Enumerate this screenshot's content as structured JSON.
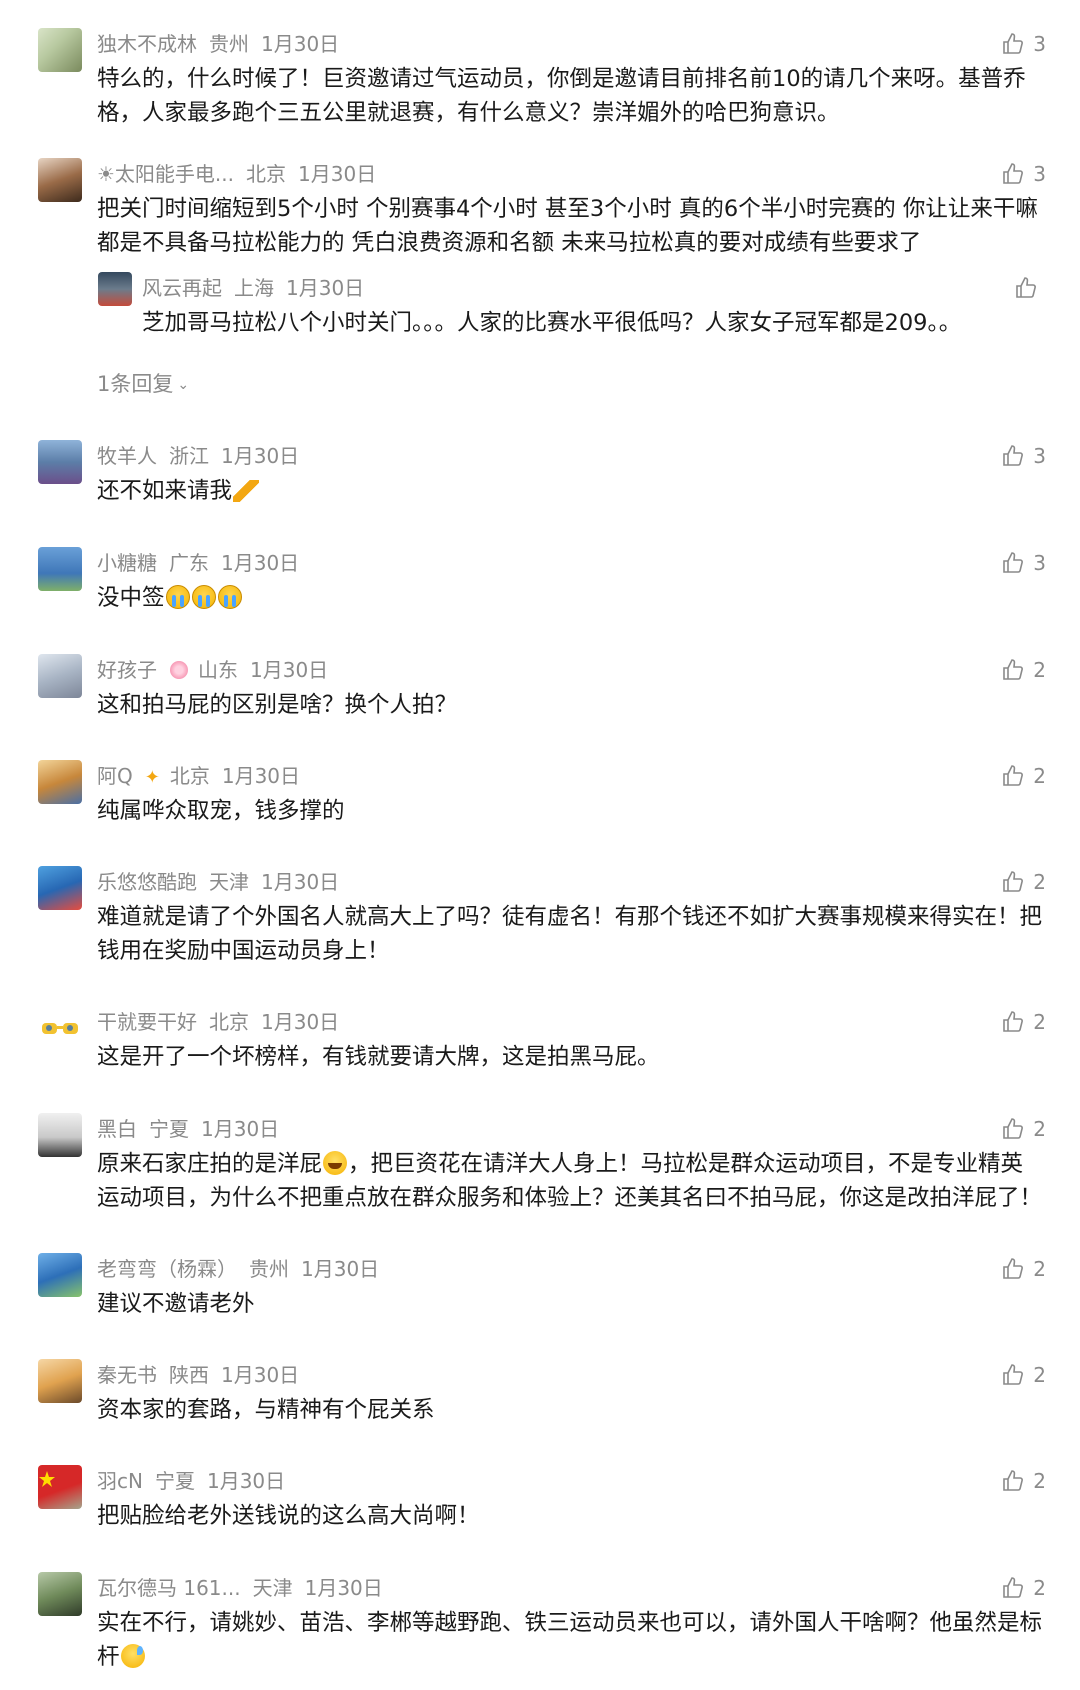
{
  "comments": [
    {
      "user": "独木不成林",
      "loc": "贵州",
      "date": "1月30日",
      "likes": "3",
      "text": "特么的，什么时候了！巨资邀请过气运动员，你倒是邀请目前排名前10的请几个来呀。基普乔格，人家最多跑个三五公里就退赛，有什么意义？崇洋媚外的哈巴狗意识。"
    },
    {
      "user": "☀太阳能手电...",
      "loc": "北京",
      "date": "1月30日",
      "likes": "3",
      "text": "把关门时间缩短到5个小时 个别赛事4个小时 甚至3个小时  真的6个半小时完赛的 你让让来干嘛 都是不具备马拉松能力的 凭白浪费资源和名额 未来马拉松真的要对成绩有些要求了",
      "reply": {
        "user": "风云再起",
        "loc": "上海",
        "date": "1月30日",
        "likes": "",
        "text": "芝加哥马拉松八个小时关门。。。人家的比赛水平很低吗？人家女子冠军都是209。。"
      },
      "more": "1条回复"
    },
    {
      "user": "牧羊人",
      "loc": "浙江",
      "date": "1月30日",
      "likes": "3",
      "text": "还不如来请我",
      "emoji": "bow-emoji"
    },
    {
      "user": "小糖糖",
      "loc": "广东",
      "date": "1月30日",
      "likes": "3",
      "text": "没中签",
      "emoji": "cry-emoji-x3"
    },
    {
      "user": "好孩子",
      "loc": "山东",
      "date": "1月30日",
      "likes": "2",
      "text": "这和拍马屁的区别是啥？换个人拍？",
      "name_emoji": "flower-emoji"
    },
    {
      "user": "阿Q",
      "loc": "北京",
      "date": "1月30日",
      "likes": "2",
      "text": "纯属哗众取宠，钱多撑的",
      "name_emoji": "runner-emoji"
    },
    {
      "user": "乐悠悠酷跑",
      "loc": "天津",
      "date": "1月30日",
      "likes": "2",
      "text": "难道就是请了个外国名人就高大上了吗？徒有虚名！有那个钱还不如扩大赛事规模来得实在！把钱用在奖励中国运动员身上！"
    },
    {
      "user": "干就要干好",
      "loc": "北京",
      "date": "1月30日",
      "likes": "2",
      "text": "这是开了一个坏榜样，有钱就要请大牌，这是拍黑马屁。"
    },
    {
      "user": "黑白",
      "loc": "宁夏",
      "date": "1月30日",
      "likes": "2",
      "text_a": "原来石家庄拍的是洋屁",
      "text_b": "，把巨资花在请洋大人身上！马拉松是群众运动项目，不是专业精英运动项目，为什么不把重点放在群众服务和体验上？还美其名曰不拍马屁，你这是改拍洋屁了！"
    },
    {
      "user": "老弯弯（杨霖）",
      "loc": "贵州",
      "date": "1月30日",
      "likes": "2",
      "text": "建议不邀请老外"
    },
    {
      "user": "秦无书",
      "loc": "陕西",
      "date": "1月30日",
      "likes": "2",
      "text": "资本家的套路，与精神有个屁关系"
    },
    {
      "user": "羽cN",
      "loc": "宁夏",
      "date": "1月30日",
      "likes": "2",
      "text": "把贴脸给老外送钱说的这么高大尚啊！"
    },
    {
      "user": "瓦尔德马 161...",
      "loc": "天津",
      "date": "1月30日",
      "likes": "2",
      "text": "实在不行，请姚妙、苗浩、李郴等越野跑、铁三运动员来也可以，请外国人干啥啊？他虽然是标杆"
    }
  ],
  "icons": {
    "like": "thumbs-up-icon",
    "chevron": "chevron-down-icon"
  },
  "colors": {
    "meta": "#8a8a8a",
    "text": "#1a1a1a"
  }
}
